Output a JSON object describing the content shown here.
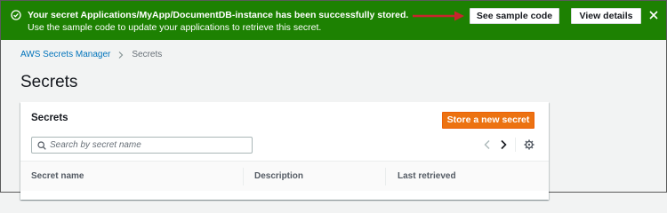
{
  "flash": {
    "title": "Your secret Applications/MyApp/DocumentDB-instance has been successfully stored.",
    "subtitle": "Use the sample code to update your applications to retrieve this secret.",
    "sample_code_label": "See sample code",
    "view_details_label": "View details",
    "color": "#1d8102",
    "arrow_color": "#c7262d"
  },
  "breadcrumb": {
    "root": "AWS Secrets Manager",
    "current": "Secrets"
  },
  "page_title": "Secrets",
  "panel": {
    "title": "Secrets",
    "primary_button_label": "Store a new secret",
    "primary_color": "#ec7211",
    "search_placeholder": "Search by secret name",
    "columns": [
      "Secret name",
      "Description",
      "Last retrieved"
    ]
  },
  "icons": {
    "flash_status": "check-circle-icon",
    "flash_close": "close-icon",
    "search": "search-icon",
    "prev": "chevron-left-icon",
    "next": "chevron-right-icon",
    "settings": "gear-icon"
  }
}
